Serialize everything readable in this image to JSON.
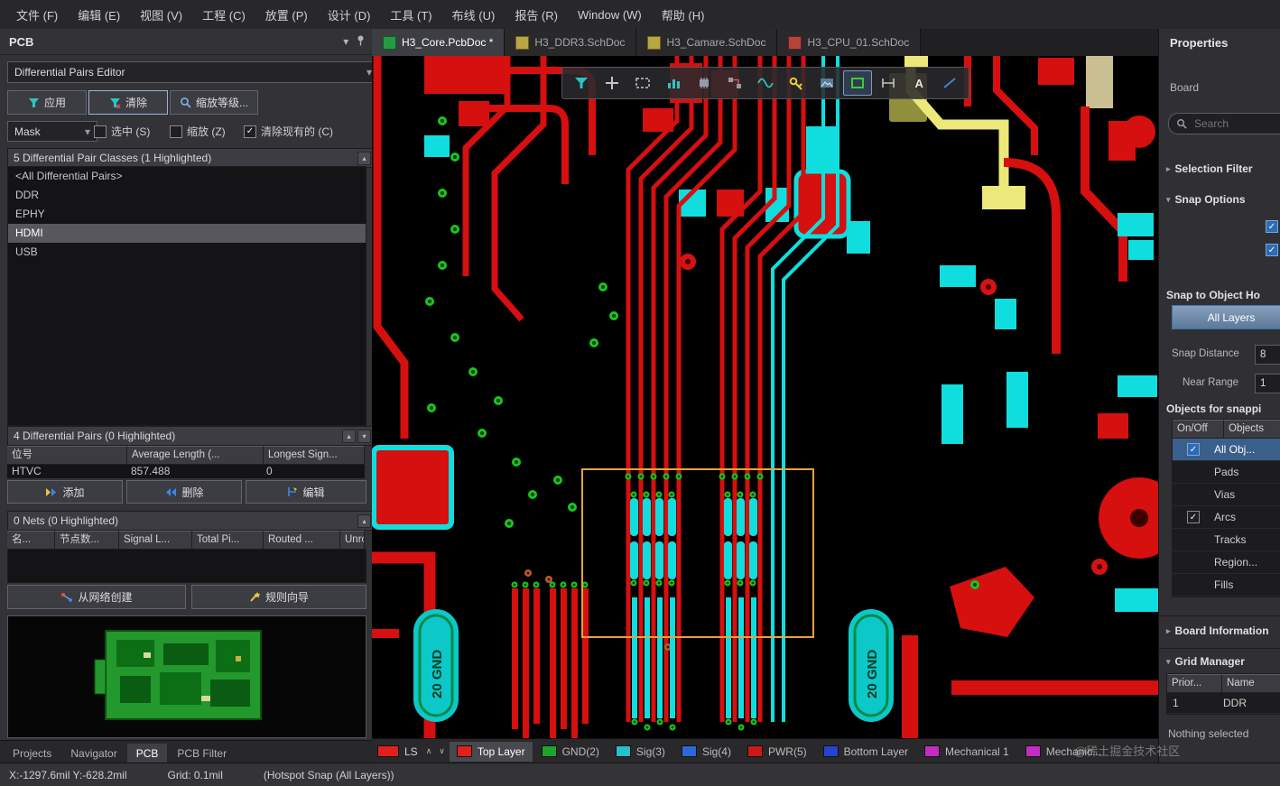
{
  "menu": {
    "items": [
      "文件 (F)",
      "编辑 (E)",
      "视图 (V)",
      "工程 (C)",
      "放置 (P)",
      "设计 (D)",
      "工具 (T)",
      "布线 (U)",
      "报告 (R)",
      "Window (W)",
      "帮助 (H)"
    ]
  },
  "doc_tabs": [
    {
      "label": "H3_Core.PcbDoc *"
    },
    {
      "label": "H3_DDR3.SchDoc"
    },
    {
      "label": "H3_Camare.SchDoc"
    },
    {
      "label": "H3_CPU_01.SchDoc"
    }
  ],
  "pcb_panel": {
    "title": "PCB",
    "editor_select": "Differential Pairs Editor",
    "apply_button": "应用",
    "clear_button": "清除",
    "zoom_level_button": "缩放等级...",
    "mask_select": "Mask",
    "select_checkbox": "选中 (S)",
    "zoom_checkbox": "缩放 (Z)",
    "clear_existing_checkbox": "清除现有的 (C)",
    "classes_header": "5 Differential Pair Classes (1 Highlighted)",
    "classes": [
      "<All Differential Pairs>",
      "DDR",
      "EPHY",
      "HDMI",
      "USB"
    ],
    "pairs_header": "4 Differential Pairs (0 Highlighted)",
    "pairs_columns": [
      "位号",
      "Average Length (...",
      "Longest Sign..."
    ],
    "pairs_rows": [
      [
        "HTVC",
        "857.488",
        "0"
      ]
    ],
    "add_button": "添加",
    "remove_button": "删除",
    "edit_button": "编辑",
    "nets_header": "0 Nets (0 Highlighted)",
    "nets_columns": [
      "名...",
      "节点数...",
      "Signal L...",
      "Total Pi...",
      "Routed ...",
      "Unrout..."
    ],
    "create_from_nets_button": "从网络创建",
    "rule_wizard_button": "规则向导",
    "bottom_tabs": [
      "Projects",
      "Navigator",
      "PCB",
      "PCB Filter"
    ]
  },
  "canvas": {
    "gnd_left": "20 GND",
    "gnd_right": "20 GND"
  },
  "properties": {
    "title": "Properties",
    "doc_scope": "Board",
    "search_placeholder": "Search",
    "selection_filter_section": "Selection Filter",
    "snap_options_section": "Snap Options",
    "snap_to_object_header": "Snap to Object Ho",
    "layer_scope_button": "All Layers",
    "snap_distance_label": "Snap Distance",
    "snap_distance_value": "8",
    "near_range_label": "Near Range",
    "near_range_value": "1",
    "objects_for_snapping": "Objects for snappi",
    "snap_table_headers": [
      "On/Off",
      "Objects"
    ],
    "snap_objects": [
      "All Obj...",
      "Pads",
      "Vias",
      "Arcs",
      "Tracks",
      "Region...",
      "Fills"
    ],
    "board_info_section": "Board Information",
    "grid_manager_section": "Grid Manager",
    "grid_headers": [
      "Prior...",
      "Name"
    ],
    "grid_rows": [
      [
        "1",
        "DDR"
      ]
    ],
    "footer_status": "Nothing selected"
  },
  "layer_bar": {
    "ls_label": "LS",
    "tabs": [
      {
        "label": "Top Layer",
        "color": "#e0201c"
      },
      {
        "label": "GND(2)",
        "color": "#1fa32a"
      },
      {
        "label": "Sig(3)",
        "color": "#25c0c8"
      },
      {
        "label": "Sig(4)",
        "color": "#2d68d8"
      },
      {
        "label": "PWR(5)",
        "color": "#cc1a1a"
      },
      {
        "label": "Bottom Layer",
        "color": "#2743d0"
      },
      {
        "label": "Mechanical 1",
        "color": "#c32cc3"
      },
      {
        "label": "Mechanic...",
        "color": "#c32cc3"
      }
    ]
  },
  "status_bar": {
    "position": "X:-1297.6mil Y:-628.2mil",
    "grid": "Grid: 0.1mil",
    "snap_mode": "(Hotspot Snap (All Layers))"
  },
  "watermark": "@稀土掘金技术社区",
  "colors": {
    "selection_box": "#e8a33d",
    "trace_red": "#d60f0f",
    "pad_cyan": "#10dede",
    "via_green": "#19c51e",
    "highlight_blue": "#3a5f8a"
  }
}
